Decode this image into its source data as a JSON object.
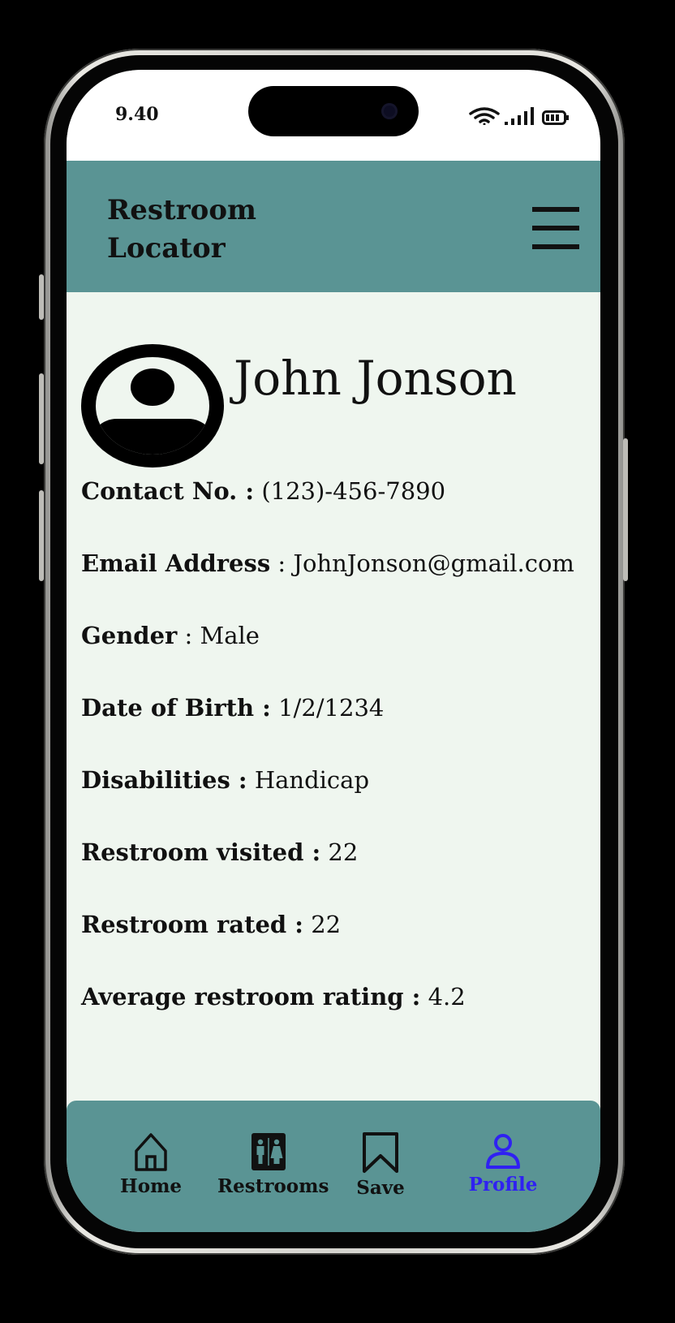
{
  "status_bar": {
    "time": "9.40",
    "icons": [
      "wifi-icon",
      "signal-icon",
      "battery-icon"
    ]
  },
  "header": {
    "title": "Restroom Locator",
    "menu_icon": "hamburger-menu-icon"
  },
  "profile": {
    "avatar_icon": "user-avatar-icon",
    "name": "John Jonson",
    "fields": [
      {
        "label": "Contact No. :",
        "value": "(123)-456-7890"
      },
      {
        "label": "Email Address",
        "value": ": JohnJonson@gmail.com"
      },
      {
        "label": "Gender",
        "value": ": Male"
      },
      {
        "label": "Date of Birth :",
        "value": "1/2/1234"
      },
      {
        "label": "Disabilities :",
        "value": "Handicap"
      },
      {
        "label": "Restroom visited :",
        "value": "22"
      },
      {
        "label": "Restroom rated :",
        "value": "22"
      },
      {
        "label": "Average restroom rating :",
        "value": "4.2"
      }
    ]
  },
  "nav": {
    "items": [
      {
        "label": "Home",
        "icon": "home-icon",
        "active": false
      },
      {
        "label": "Restrooms",
        "icon": "restroom-icon",
        "active": false
      },
      {
        "label": "Save",
        "icon": "bookmark-icon",
        "active": false
      },
      {
        "label": "Profile",
        "icon": "profile-icon",
        "active": true
      }
    ]
  },
  "colors": {
    "header_bg": "#5a9494",
    "content_bg": "#eff6ef",
    "active_nav": "#2f21f2",
    "text": "#111111"
  }
}
